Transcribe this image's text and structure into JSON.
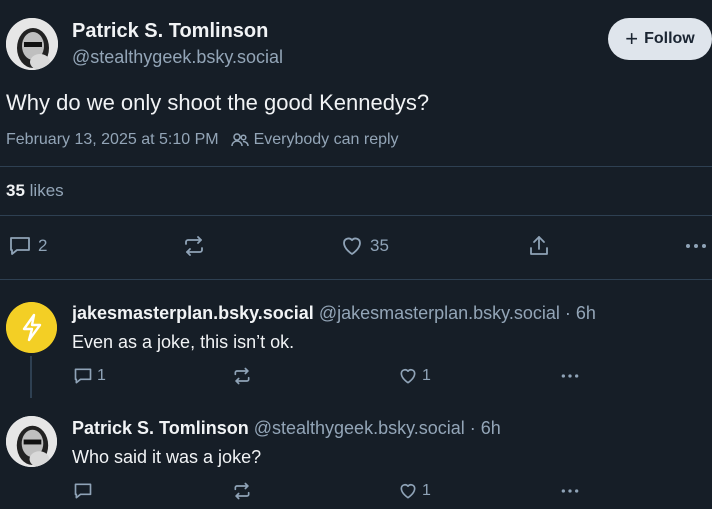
{
  "post": {
    "author_name": "Patrick S. Tomlinson",
    "author_handle": "@stealthygeek.bsky.social",
    "follow_label": "Follow",
    "text": "Why do we only shoot the good Kennedys?",
    "timestamp": "February 13, 2025 at 5:10 PM",
    "reply_setting": "Everybody can reply",
    "likes_count": "35",
    "likes_label": "likes",
    "reply_count": "2",
    "like_count": "35"
  },
  "replies": [
    {
      "author_name": "jakesmasterplan.bsky.social",
      "author_handle": "@jakesmasterplan.bsky.social",
      "age": "· 6h",
      "text": "Even as a joke, this isn’t ok.",
      "reply_count": "1",
      "like_count": "1"
    },
    {
      "author_name": "Patrick S. Tomlinson",
      "author_handle": "@stealthygeek.bsky.social",
      "age": "· 6h",
      "text": "Who said it was a joke?",
      "reply_count": "",
      "like_count": "1"
    }
  ],
  "colors": {
    "background": "#161e27",
    "text": "#f1f3f5",
    "muted": "#93a5b7",
    "divider": "#2e4052",
    "follow_bg": "#dfe5ec",
    "avatar_yellow": "#f3cf25"
  }
}
